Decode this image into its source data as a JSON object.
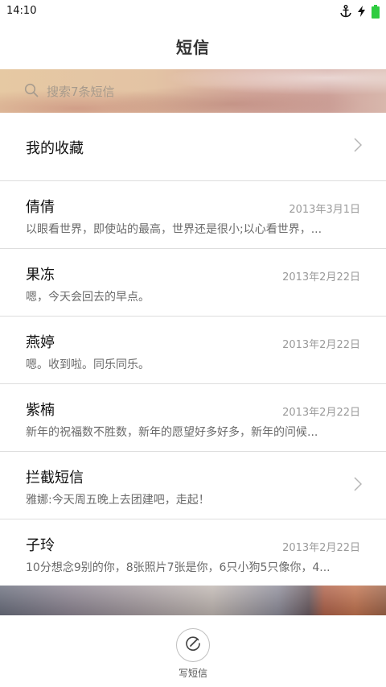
{
  "status_bar": {
    "time": "14:10",
    "icons": [
      "anchor-icon",
      "charging-bolt-icon",
      "battery-icon"
    ],
    "battery_color": "#2ecc40"
  },
  "header": {
    "title": "短信"
  },
  "search": {
    "placeholder": "搜索7条短信",
    "icon": "search-icon"
  },
  "favorites": {
    "label": "我的收藏"
  },
  "conversations": [
    {
      "name": "倩倩",
      "date": "2013年3月1日",
      "preview": "以眼看世界，即使站的最高，世界还是很小;以心看世界，..."
    },
    {
      "name": "果冻",
      "date": "2013年2月22日",
      "preview": "嗯，今天会回去的早点。"
    },
    {
      "name": "燕婷",
      "date": "2013年2月22日",
      "preview": "嗯。收到啦。同乐同乐。"
    },
    {
      "name": "紫楠",
      "date": "2013年2月22日",
      "preview": "新年的祝福数不胜数，新年的愿望好多好多，新年的问候..."
    },
    {
      "name": "拦截短信",
      "date": "",
      "preview": "雅娜:今天周五晚上去团建吧，走起！",
      "chevron": true
    },
    {
      "name": "子玲",
      "date": "2013年2月22日",
      "preview": "10分想念9别的你，8张照片7张是你，6只小狗5只像你，4..."
    }
  ],
  "toolbar": {
    "compose_label": "写短信",
    "compose_icon": "compose-icon"
  }
}
